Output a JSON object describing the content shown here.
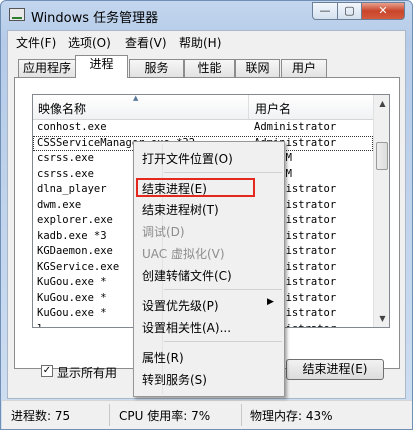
{
  "window": {
    "title": "Windows 任务管理器",
    "min_label": "—",
    "max_label": "▢",
    "close_label": "✕"
  },
  "menu": {
    "items": [
      "文件(F)",
      "选项(O)",
      "查看(V)",
      "帮助(H)"
    ]
  },
  "tabs": {
    "items": [
      "应用程序",
      "进程",
      "服务",
      "性能",
      "联网",
      "用户"
    ],
    "active_index": 1
  },
  "table": {
    "columns": [
      "映像名称",
      "用户名"
    ],
    "rows": [
      [
        "conhost.exe",
        "Administrator"
      ],
      [
        "CSSServiceManager.exe *32",
        "Administrator"
      ],
      [
        "csrss.exe",
        "SYSTEM"
      ],
      [
        "csrss.exe",
        "SYSTEM"
      ],
      [
        "dlna_player",
        "Administrator"
      ],
      [
        "dwm.exe",
        "Administrator"
      ],
      [
        "explorer.exe",
        "Administrator"
      ],
      [
        "kadb.exe *3",
        "Administrator"
      ],
      [
        "KGDaemon.exe",
        "Administrator"
      ],
      [
        "KGService.exe",
        "Administrator"
      ],
      [
        "KuGou.exe *",
        "Administrator"
      ],
      [
        "KuGou.exe *",
        "Administrator"
      ],
      [
        "KuGou.exe *",
        "Administrator"
      ],
      [
        "l",
        "Administrator"
      ]
    ]
  },
  "context_menu": {
    "items": [
      {
        "label": "打开文件位置(O)",
        "disabled": false
      },
      {
        "label": "结束进程(E)",
        "disabled": false,
        "highlighted": true
      },
      {
        "label": "结束进程树(T)",
        "disabled": false
      },
      {
        "label": "调试(D)",
        "disabled": true
      },
      {
        "label": "UAC 虚拟化(V)",
        "disabled": true
      },
      {
        "label": "创建转储文件(C)",
        "disabled": false
      },
      {
        "label": "设置优先级(P)",
        "disabled": false,
        "submenu": true
      },
      {
        "label": "设置相关性(A)...",
        "disabled": false
      },
      {
        "label": "属性(R)",
        "disabled": false
      },
      {
        "label": "转到服务(S)",
        "disabled": false
      }
    ],
    "highlight_color": "#e4281d"
  },
  "show_all": {
    "label": "显示所有用",
    "checked": true
  },
  "end_process_button": "结束进程(E)",
  "status": {
    "processes": "进程数: 75",
    "cpu": "CPU 使用率: 7%",
    "memory": "物理内存: 43%"
  }
}
